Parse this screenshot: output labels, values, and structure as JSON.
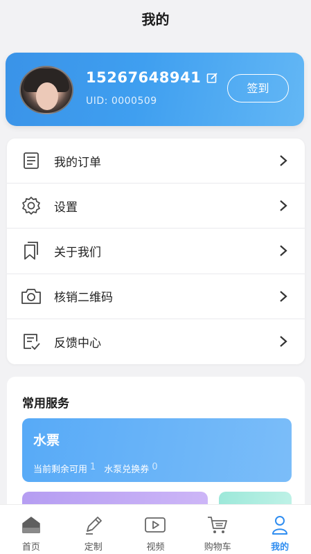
{
  "header": {
    "title": "我的"
  },
  "profile": {
    "phone": "15267648941",
    "uid": "UID: 0000509",
    "checkin_label": "签到",
    "edit_icon": "edit-icon",
    "avatar_icon": "avatar"
  },
  "menu": {
    "items": [
      {
        "label": "我的订单",
        "icon": "order-list-icon"
      },
      {
        "label": "设置",
        "icon": "gear-icon"
      },
      {
        "label": "关于我们",
        "icon": "bookmark-icon"
      },
      {
        "label": "核销二维码",
        "icon": "camera-icon"
      },
      {
        "label": "反馈中心",
        "icon": "feedback-icon"
      }
    ]
  },
  "services": {
    "title": "常用服务",
    "ticket": {
      "title": "水票",
      "remaining_label": "当前剩余可用",
      "remaining_count": "1",
      "coupon_label": "水泵兑换券",
      "coupon_count": "0"
    }
  },
  "tabbar": {
    "items": [
      {
        "label": "首页",
        "icon": "home-icon",
        "active": false
      },
      {
        "label": "定制",
        "icon": "pen-icon",
        "active": false
      },
      {
        "label": "视频",
        "icon": "video-icon",
        "active": false
      },
      {
        "label": "购物车",
        "icon": "cart-icon",
        "active": false
      },
      {
        "label": "我的",
        "icon": "user-icon",
        "active": true
      }
    ]
  },
  "colors": {
    "accent": "#2f8df0",
    "profile_gradient_start": "#3a93e8",
    "ticket_gradient": "#57aaf7"
  }
}
